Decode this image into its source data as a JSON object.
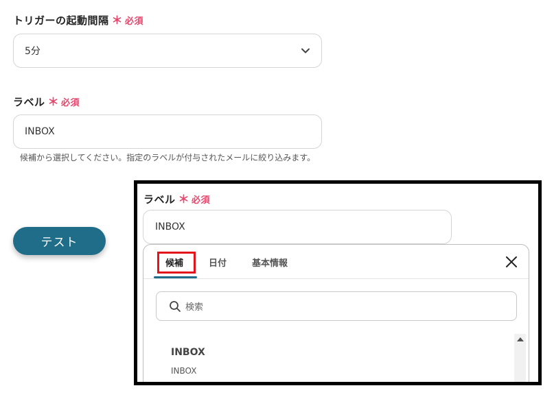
{
  "trigger": {
    "label": "トリガーの起動間隔",
    "required_mark": "＊",
    "required_text": "必須",
    "selected_value": "5分"
  },
  "label_field": {
    "label": "ラベル",
    "required_mark": "＊",
    "required_text": "必須",
    "value": "INBOX",
    "hint": "候補から選択してください。指定のラベルが付与されたメールに絞り込みます。"
  },
  "test_button": {
    "label": "テスト"
  },
  "overlay": {
    "label": "ラベル",
    "required_mark": "＊",
    "required_text": "必須",
    "value": "INBOX",
    "tabs": [
      {
        "label": "候補",
        "active": true
      },
      {
        "label": "日付",
        "active": false
      },
      {
        "label": "基本情報",
        "active": false
      }
    ],
    "search_placeholder": "検索",
    "items": [
      {
        "title": "INBOX",
        "subtitle": "INBOX"
      }
    ]
  },
  "colors": {
    "accent": "#1f6d89",
    "required": "#e5456b",
    "highlight": "#e3131c"
  }
}
